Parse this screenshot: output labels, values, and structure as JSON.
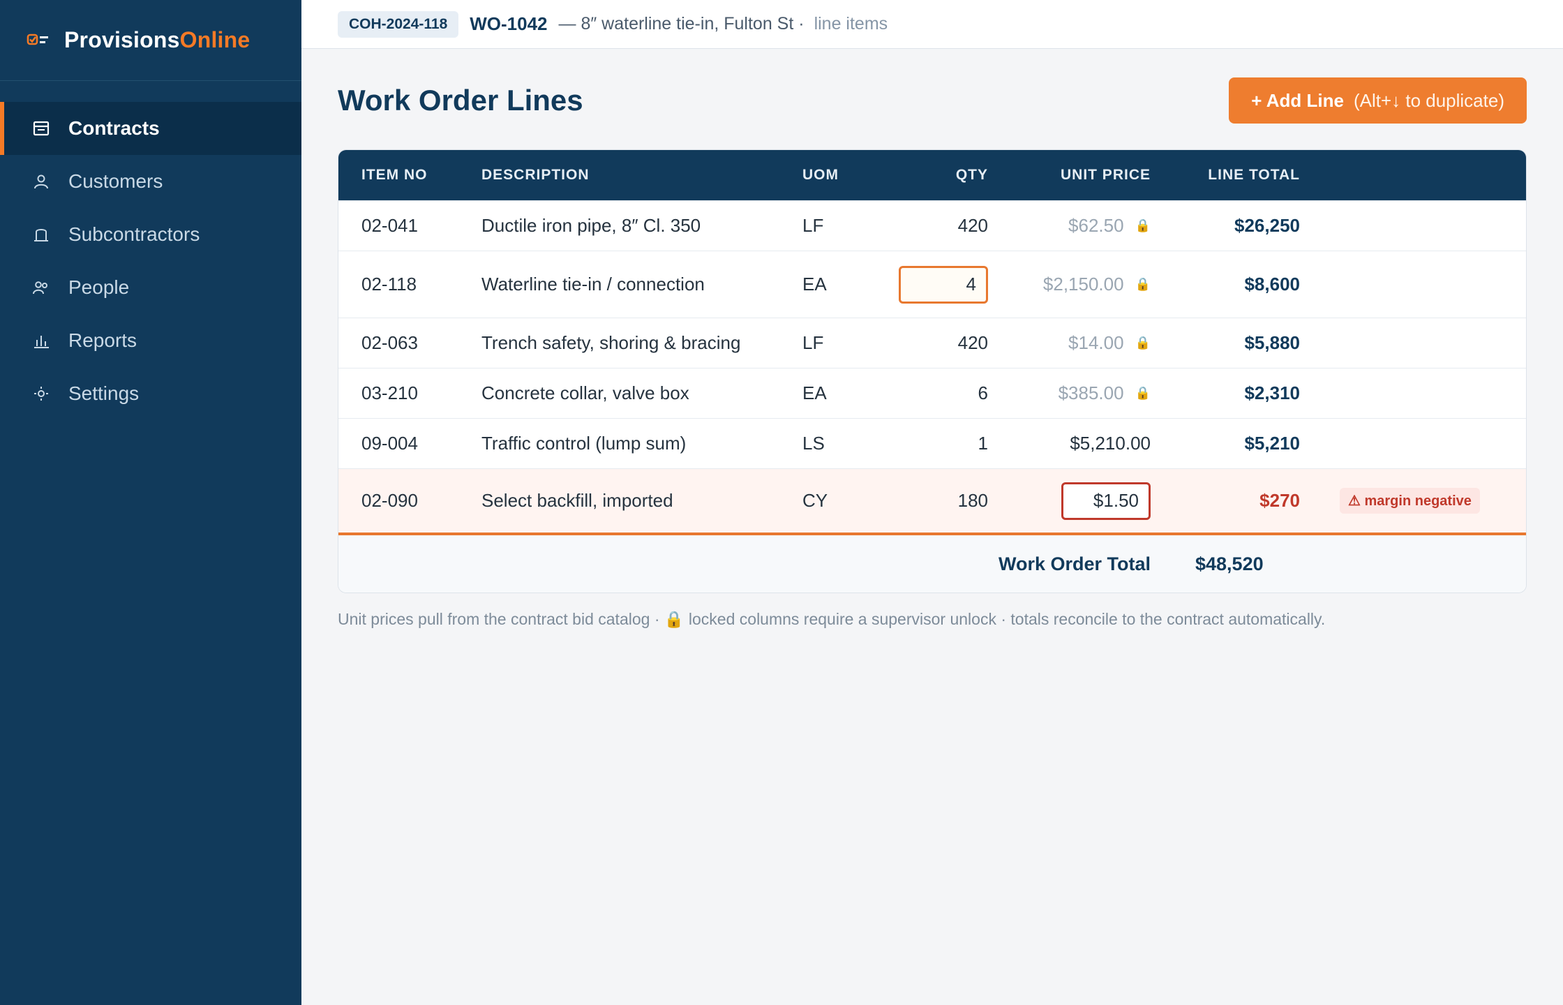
{
  "brand": {
    "name": "Provisions",
    "accent": "Online",
    "accent_color": "#f57a26",
    "icon": "checklist-icon"
  },
  "sidebar": {
    "items": [
      {
        "label": "Contracts",
        "icon": "contract-icon",
        "active": true
      },
      {
        "label": "Customers",
        "icon": "person-icon",
        "active": false
      },
      {
        "label": "Subcontractors",
        "icon": "building-icon",
        "active": false
      },
      {
        "label": "People",
        "icon": "people-icon",
        "active": false
      },
      {
        "label": "Reports",
        "icon": "bar-chart-icon",
        "active": false
      },
      {
        "label": "Settings",
        "icon": "gear-icon",
        "active": false
      }
    ]
  },
  "topbar": {
    "contract_id": "COH-2024-118",
    "work_order_id": "WO-1042",
    "work_order_desc": "— 8″ waterline tie-in, Fulton St ·",
    "section": "line items"
  },
  "main": {
    "title": "Work Order Lines",
    "add_button": {
      "label": "+ Add Line",
      "hint": "(Alt+↓ to duplicate)"
    },
    "columns": [
      "ITEM NO",
      "DESCRIPTION",
      "UOM",
      "QTY",
      "UNIT PRICE",
      "LINE TOTAL"
    ],
    "rows": [
      {
        "item": "02-041",
        "desc": "Ductile iron pipe, 8″ Cl. 350",
        "uom": "LF",
        "qty": "420",
        "price": "$62.50",
        "locked": true,
        "total": "$26,250"
      },
      {
        "item": "02-118",
        "desc": "Waterline tie-in / connection",
        "uom": "EA",
        "qty": "4",
        "price": "$2,150.00",
        "locked": true,
        "total": "$8,600",
        "qty_editing": true
      },
      {
        "item": "02-063",
        "desc": "Trench safety, shoring & bracing",
        "uom": "LF",
        "qty": "420",
        "price": "$14.00",
        "locked": true,
        "total": "$5,880"
      },
      {
        "item": "03-210",
        "desc": "Concrete collar, valve box",
        "uom": "EA",
        "qty": "6",
        "price": "$385.00",
        "locked": true,
        "total": "$2,310"
      },
      {
        "item": "09-004",
        "desc": "Traffic control (lump sum)",
        "uom": "LS",
        "qty": "1",
        "price": "$5,210.00",
        "locked": false,
        "total": "$5,210"
      },
      {
        "item": "02-090",
        "desc": "Select backfill, imported",
        "uom": "CY",
        "qty": "180",
        "price": "$1.50",
        "locked": false,
        "total": "$270",
        "price_editing": true,
        "warning": "⚠ margin negative"
      }
    ],
    "lock_glyph": "🔒",
    "footer": {
      "label": "Work Order Total",
      "value": "$48,520"
    },
    "note": "Unit prices pull from the contract bid catalog · 🔒 locked columns require a supervisor unlock · totals reconcile to the contract automatically."
  },
  "colors": {
    "sidebar": "#113a5b",
    "accent": "#ee7d2f",
    "danger": "#c0392b"
  }
}
